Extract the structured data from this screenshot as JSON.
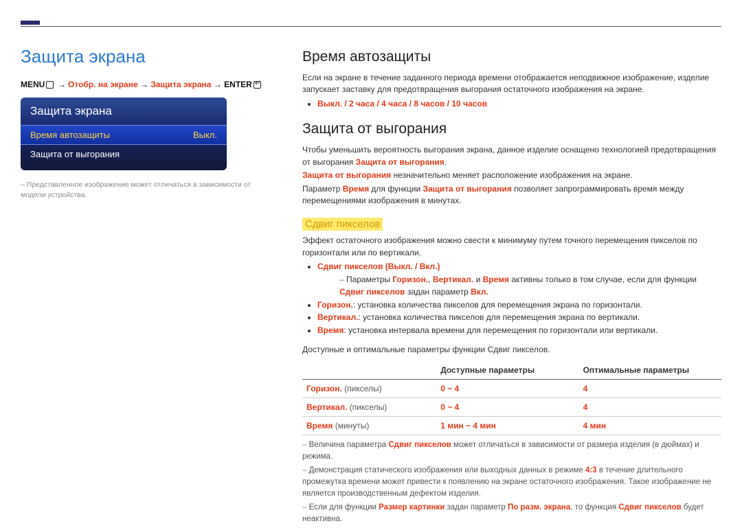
{
  "page_title": "Защита экрана",
  "breadcrumb": {
    "menu": "MENU",
    "arrow": " → ",
    "p1": "Отобр. на экране",
    "p2": "Защита экрана",
    "enter": "ENTER"
  },
  "osd": {
    "title": "Защита экрана",
    "rows": [
      {
        "label": "Время автозащиты",
        "value": "Выкл.",
        "selected": true
      },
      {
        "label": "Защита от выгорания",
        "value": "",
        "selected": false
      }
    ]
  },
  "disclaimer": "Представленное изображение может отличаться в зависимости от модели устройства.",
  "s1": {
    "title": "Время автозащиты",
    "desc": "Если на экране в течение заданного периода времени отображается неподвижное изображение, изделие запускает заставку для предотвращения выгорания остаточного изображения на экране.",
    "options": "Выкл. / 2 часа / 4 часа / 8 часов / 10 часов"
  },
  "s2": {
    "title": "Защита от выгорания",
    "p1a": "Чтобы уменьшить вероятность выгорания экрана, данное изделие оснащено технологией предотвращения от выгорания ",
    "p1b": "Защита от выгорания",
    "p1c": ".",
    "p2a": "Защита от выгорания",
    "p2b": " незначительно меняет расположение изображения на экране.",
    "p3a": "Параметр ",
    "p3b": "Время",
    "p3c": " для функции ",
    "p3d": "Защита от выгорания",
    "p3e": " позволяет запрограммировать время между перемещениями изображения в минутах."
  },
  "pixel": {
    "heading": "Сдвиг пикселов",
    "desc": "Эффект остаточного изображения можно свести к минимуму путем точного перемещения пикселов по горизонтали или по вертикали.",
    "li1_label": "Сдвиг пикселов",
    "li1_vals": " (Выкл. / Вкл.)",
    "note1_a": "Параметры ",
    "note1_b": "Горизон.",
    "note1_c": ", ",
    "note1_d": "Вертикал.",
    "note1_e": " и ",
    "note1_f": "Время",
    "note1_g": " активны только в том случае, если для функции ",
    "note1_h": "Сдвиг пикселов",
    "note1_i": " задан параметр ",
    "note1_j": "Вкл.",
    "li2_label": "Горизон.",
    "li2_text": ": установка количества пикселов для перемещения экрана по горизонтали.",
    "li3_label": "Вертикал.",
    "li3_text": ": установка количества пикселов для перемещения экрана по вертикали.",
    "li4_label": "Время",
    "li4_text": ": установка интервала времени для перемещения по горизонтали или вертикали."
  },
  "table": {
    "caption": "Доступные и оптимальные параметры функции Сдвиг пикселов.",
    "h1": "",
    "h2": "Доступные параметры",
    "h3": "Оптимальные параметры",
    "rows": [
      {
        "name": "Горизон.",
        "unit": " (пикселы)",
        "avail": "0 ~ 4",
        "opt": "4"
      },
      {
        "name": "Вертикал.",
        "unit": " (пикселы)",
        "avail": "0 ~ 4",
        "opt": "4"
      },
      {
        "name": "Время",
        "unit": " (минуты)",
        "avail": "1 мин ~ 4 мин",
        "opt": "4 мин"
      }
    ]
  },
  "footnotes": {
    "n1a": "Величина параметра ",
    "n1b": "Сдвиг пикселов",
    "n1c": " может отличаться в зависимости от размера изделия (в дюймах) и режима.",
    "n2a": "Демонстрация статического изображения или выходных данных в режиме ",
    "n2b": "4:3",
    "n2c": " в течение длительного промежутка времени может привести к появлению на экране остаточного изображения. Такое изображение не является производственным дефектом изделия.",
    "n3a": "Если для функции ",
    "n3b": "Размер картинки",
    "n3c": " задан параметр ",
    "n3d": "По разм. экрана",
    "n3e": ", то функция ",
    "n3f": "Сдвиг пикселов",
    "n3g": " будет неактивна."
  }
}
